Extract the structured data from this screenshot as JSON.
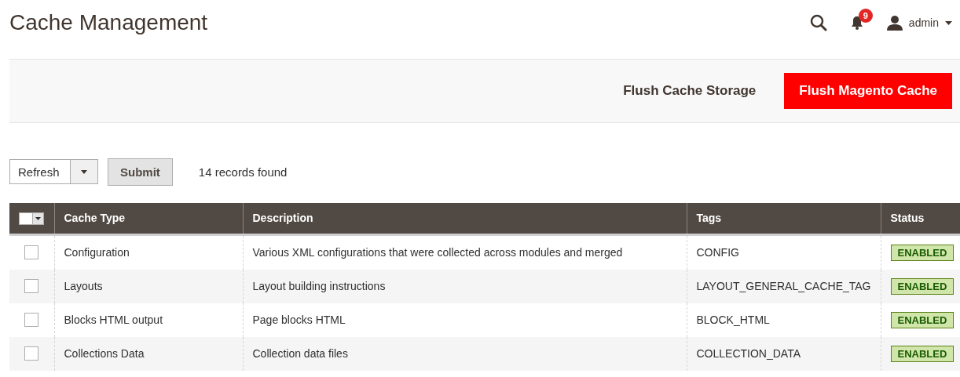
{
  "page_title": "Cache Management",
  "header": {
    "notifications": "9",
    "user": "admin"
  },
  "actions": {
    "secondary": "Flush Cache Storage",
    "primary": "Flush Magento Cache"
  },
  "toolbar": {
    "mass_action": "Refresh",
    "submit": "Submit",
    "records": "14 records found"
  },
  "table": {
    "columns": [
      "Cache Type",
      "Description",
      "Tags",
      "Status"
    ],
    "rows": [
      {
        "checked": false,
        "cache_type": "Configuration",
        "description": "Various XML configurations that were collected across modules and merged",
        "tags": "CONFIG",
        "status": "ENABLED",
        "enabled": true
      },
      {
        "checked": false,
        "cache_type": "Layouts",
        "description": "Layout building instructions",
        "tags": "LAYOUT_GENERAL_CACHE_TAG",
        "status": "ENABLED",
        "enabled": true
      },
      {
        "checked": false,
        "cache_type": "Blocks HTML output",
        "description": "Page blocks HTML",
        "tags": "BLOCK_HTML",
        "status": "ENABLED",
        "enabled": true
      },
      {
        "checked": false,
        "cache_type": "Collections Data",
        "description": "Collection data files",
        "tags": "COLLECTION_DATA",
        "status": "ENABLED",
        "enabled": true
      }
    ]
  }
}
